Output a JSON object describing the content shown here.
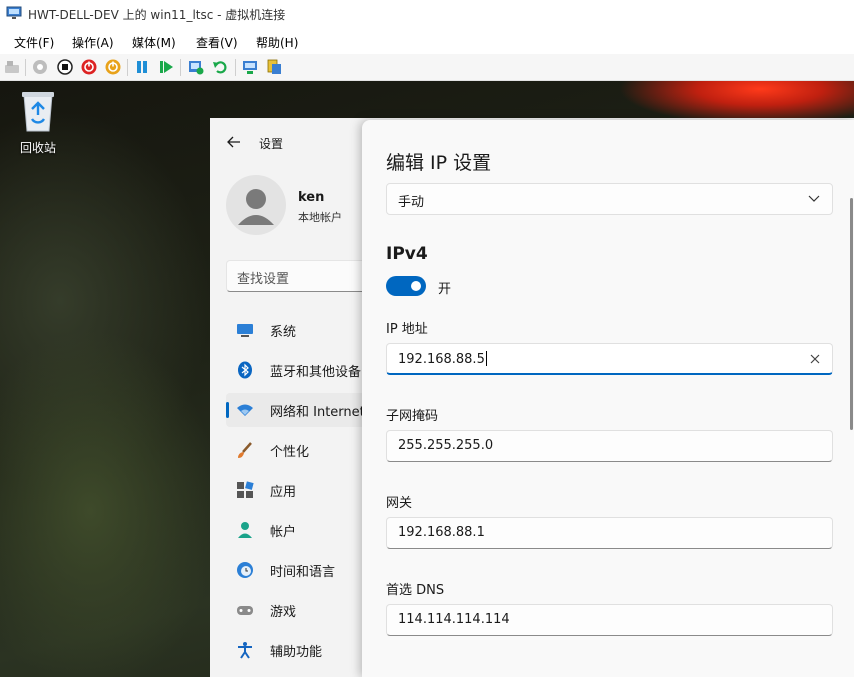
{
  "window": {
    "title": "HWT-DELL-DEV 上的 win11_ltsc - 虚拟机连接"
  },
  "menu": [
    "文件(F)",
    "操作(A)",
    "媒体(M)",
    "查看(V)",
    "帮助(H)"
  ],
  "toolbar": {
    "icons": [
      "ctrl-alt-del-icon",
      "start-icon",
      "turn-off-icon",
      "shut-down-icon",
      "power-icon",
      "pause-icon",
      "resume-icon",
      "checkpoint-icon",
      "revert-icon",
      "enhanced-session-icon",
      "share-icon"
    ]
  },
  "desktop": {
    "recycle_bin_label": "回收站"
  },
  "settings": {
    "title": "设置",
    "user_name": "ken",
    "account_type": "本地帐户",
    "search_placeholder": "查找设置",
    "nav": [
      {
        "label": "系统",
        "icon": "monitor-icon"
      },
      {
        "label": "蓝牙和其他设备",
        "icon": "bluetooth-icon"
      },
      {
        "label": "网络和 Internet",
        "icon": "wifi-icon",
        "selected": true
      },
      {
        "label": "个性化",
        "icon": "brush-icon"
      },
      {
        "label": "应用",
        "icon": "apps-icon"
      },
      {
        "label": "帐户",
        "icon": "person-icon"
      },
      {
        "label": "时间和语言",
        "icon": "clock-globe-icon"
      },
      {
        "label": "游戏",
        "icon": "gamepad-icon"
      },
      {
        "label": "辅助功能",
        "icon": "accessibility-icon"
      }
    ]
  },
  "dialog": {
    "title": "编辑 IP 设置",
    "mode": "手动",
    "section": "IPv4",
    "toggle_state": "开",
    "toggle_on": true,
    "ip_label": "IP 地址",
    "ip_value": "192.168.88.5",
    "subnet_label": "子网掩码",
    "subnet_value": "255.255.255.0",
    "gateway_label": "网关",
    "gateway_value": "192.168.88.1",
    "dns_label": "首选 DNS",
    "dns_value": "114.114.114.114"
  },
  "colors": {
    "accent": "#0067c0",
    "settings_bg": "#f3f3f3",
    "dialog_bg": "#f9f9f9"
  }
}
